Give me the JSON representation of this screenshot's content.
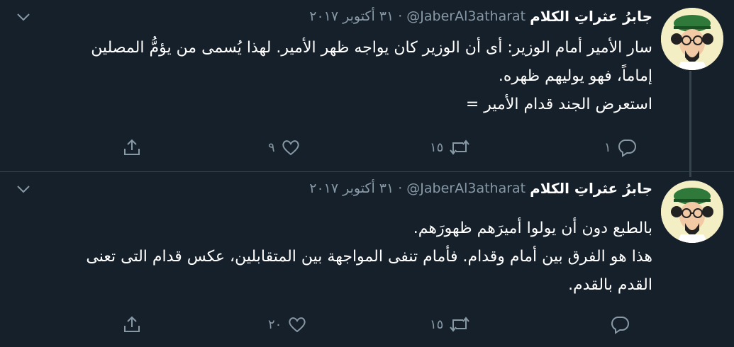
{
  "tweets": [
    {
      "author_name": "جابرُ عثراتِ الكلام",
      "handle": "@JaberAl3atharat",
      "separator": "·",
      "date": "٣١ أكتوبر ٢٠١٧",
      "body_lines": [
        "سار الأمير أمام الوزير: أى أن الوزير كان يواجه ظهر الأمير. لهذا يُسمى من يؤمُّ المصلين",
        "إماماً، فهو يوليهم ظهره.",
        "استعرض الجند قدام الأمير ="
      ],
      "reply_count": "١",
      "retweet_count": "١٥",
      "like_count": "٩"
    },
    {
      "author_name": "جابرُ عثراتِ الكلام",
      "handle": "@JaberAl3atharat",
      "separator": "·",
      "date": "٣١ أكتوبر ٢٠١٧",
      "body_lines": [
        "بالطبع دون أن يولوا أميرَهم ظهورَهم.",
        "هذا هو الفرق بين أمام وقدام. فأمام تنفى المواجهة بين المتقابلين، عكس قدام التى تعنى",
        "القدم بالقدم."
      ],
      "reply_count": "",
      "retweet_count": "١٥",
      "like_count": "٢٠"
    }
  ],
  "icons": {
    "avatar": "cartoon-avatar",
    "caret": "chevron-down-icon",
    "reply": "reply-icon",
    "retweet": "retweet-icon",
    "like": "heart-icon",
    "share": "share-icon"
  },
  "colors": {
    "background": "#15202b",
    "secondary_text": "#8899a6",
    "divider": "#38444d",
    "avatar_bg": "#f4eec4",
    "hat_green": "#2f7a3a"
  }
}
